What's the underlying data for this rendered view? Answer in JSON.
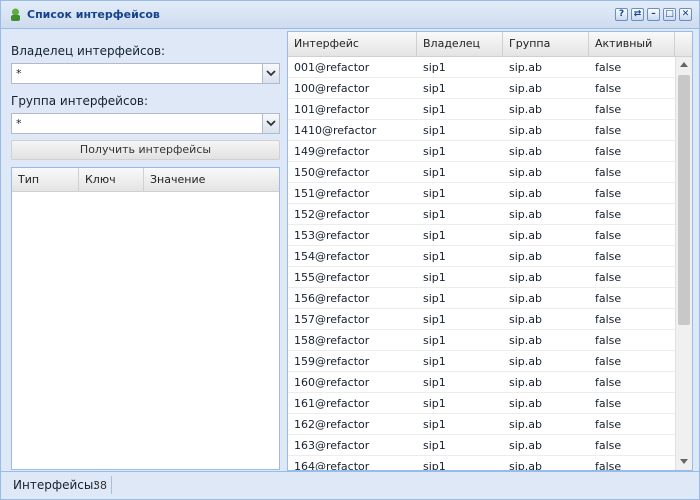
{
  "window": {
    "title": "Список интерфейсов",
    "buttons": [
      "?",
      "⇄",
      "–",
      "□",
      "✕"
    ]
  },
  "filters": {
    "owner_label": "Владелец интерфейсов:",
    "owner_value": "*",
    "group_label": "Группа интерфейсов:",
    "group_value": "*",
    "get_button": "Получить интерфейсы"
  },
  "kv_grid": {
    "columns": [
      "Тип",
      "Ключ",
      "Значение"
    ]
  },
  "interfaces": {
    "columns": [
      "Интерфейс",
      "Владелец",
      "Группа",
      "Активный"
    ],
    "rows": [
      [
        "001@refactor",
        "sip1",
        "sip.ab",
        "false"
      ],
      [
        "100@refactor",
        "sip1",
        "sip.ab",
        "false"
      ],
      [
        "101@refactor",
        "sip1",
        "sip.ab",
        "false"
      ],
      [
        "1410@refactor",
        "sip1",
        "sip.ab",
        "false"
      ],
      [
        "149@refactor",
        "sip1",
        "sip.ab",
        "false"
      ],
      [
        "150@refactor",
        "sip1",
        "sip.ab",
        "false"
      ],
      [
        "151@refactor",
        "sip1",
        "sip.ab",
        "false"
      ],
      [
        "152@refactor",
        "sip1",
        "sip.ab",
        "false"
      ],
      [
        "153@refactor",
        "sip1",
        "sip.ab",
        "false"
      ],
      [
        "154@refactor",
        "sip1",
        "sip.ab",
        "false"
      ],
      [
        "155@refactor",
        "sip1",
        "sip.ab",
        "false"
      ],
      [
        "156@refactor",
        "sip1",
        "sip.ab",
        "false"
      ],
      [
        "157@refactor",
        "sip1",
        "sip.ab",
        "false"
      ],
      [
        "158@refactor",
        "sip1",
        "sip.ab",
        "false"
      ],
      [
        "159@refactor",
        "sip1",
        "sip.ab",
        "false"
      ],
      [
        "160@refactor",
        "sip1",
        "sip.ab",
        "false"
      ],
      [
        "161@refactor",
        "sip1",
        "sip.ab",
        "false"
      ],
      [
        "162@refactor",
        "sip1",
        "sip.ab",
        "false"
      ],
      [
        "163@refactor",
        "sip1",
        "sip.ab",
        "false"
      ],
      [
        "164@refactor",
        "sip1",
        "sip.ab",
        "false"
      ]
    ]
  },
  "status": {
    "label": "Интерфейсы:",
    "count": "38"
  },
  "colors": {
    "title": "#15428b",
    "border": "#99bbe8",
    "background": "#dfe8f6"
  }
}
